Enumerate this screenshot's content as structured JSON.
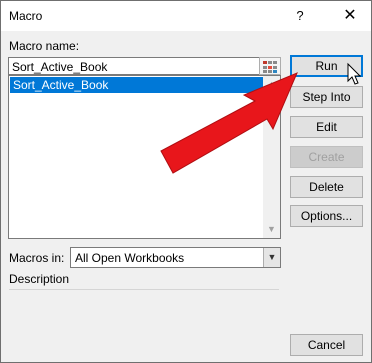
{
  "window": {
    "title": "Macro"
  },
  "titlebar": {
    "help": "?",
    "close": "✕"
  },
  "macro_name": {
    "label": "Macro name:",
    "value": "Sort_Active_Book"
  },
  "macro_list": {
    "items": [
      "Sort_Active_Book"
    ]
  },
  "buttons": {
    "run": "Run",
    "step_into": "Step Into",
    "edit": "Edit",
    "create": "Create",
    "delete": "Delete",
    "options": "Options...",
    "cancel": "Cancel"
  },
  "macros_in": {
    "label": "Macros in:",
    "value": "All Open Workbooks"
  },
  "description": {
    "label": "Description"
  },
  "colors": {
    "accent": "#0078d7",
    "annotation_arrow": "#e8161b"
  }
}
